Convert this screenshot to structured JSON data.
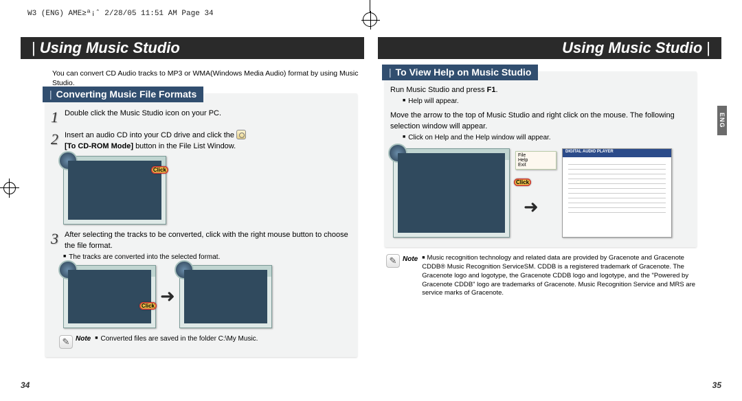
{
  "header_line": "W3 (ENG) AME≥ª¡ˆ  2/28/05 11:51 AM  Page 34",
  "chapter_title": "Using Music Studio",
  "intro": "You can convert CD Audio tracks to MP3 or WMA(Windows Media Audio) format by using Music Studio.",
  "left": {
    "panel_title": "Converting Music File Formats",
    "steps": [
      {
        "num": "1",
        "text": "Double click the Music Studio icon on your PC."
      },
      {
        "num": "2",
        "text_before": "Insert an audio CD into your CD drive and click the ",
        "text_after": " [To CD-ROM Mode] button in the File List Window.",
        "bold_part": "[To CD-ROM Mode]"
      },
      {
        "num": "3",
        "text": "After selecting the tracks to be converted, click with the right mouse button to choose the file format."
      }
    ],
    "sub1": "The tracks are converted into the selected format.",
    "click": "Click",
    "note_label": "Note",
    "note_text": "Converted files are saved in the folder C:\\My Music.",
    "page_num": "34"
  },
  "right": {
    "panel_title": "To View Help on Music Studio",
    "line1_a": "Run Music Studio and press ",
    "line1_b": "F1",
    "line1_c": ".",
    "sub1": "Help will appear.",
    "line2": "Move the arrow to the top of Music Studio and right click on the mouse. The following selection window will appear.",
    "sub2": "Click on Help and the Help window will appear.",
    "help_header": "DIGITAL AUDIO PLAYER",
    "click": "Click",
    "note_label": "Note",
    "note_text": "Music recognition technology and related data are provided by Gracenote and Gracenote CDDB® Music Recognition ServiceSM. CDDB is a registered trademark of Gracenote. The Gracenote logo and logotype, the Gracenote CDDB logo and logotype, and the \"Powered by Gracenote CDDB\" logo are trademarks of Gracenote. Music Recognition Service and MRS are service marks of Gracenote.",
    "page_num": "35",
    "lang_tab": "ENG"
  }
}
